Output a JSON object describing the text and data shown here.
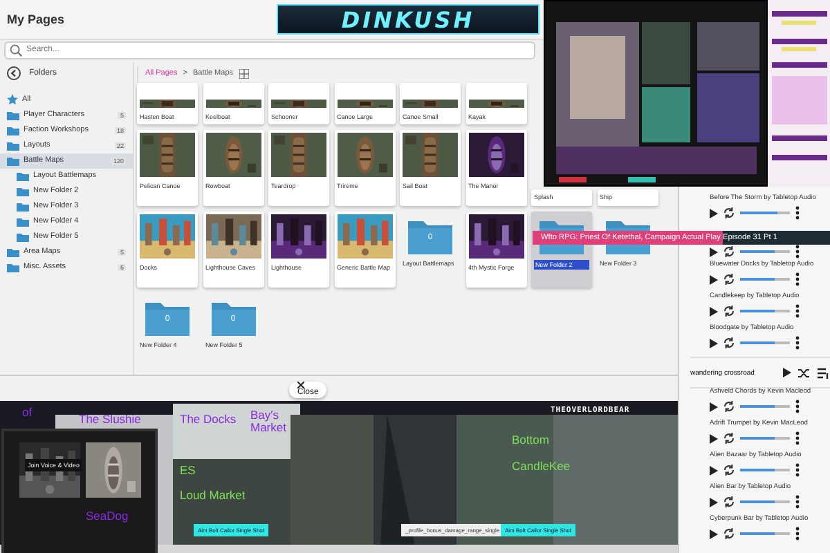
{
  "header": {
    "title": "My Pages",
    "logo": "DINKUSH"
  },
  "search": {
    "placeholder": "Search..."
  },
  "sidebar": {
    "title": "Folders",
    "items": [
      {
        "label": "All",
        "kind": "all",
        "selected": false
      },
      {
        "label": "Player Characters",
        "kind": "folder",
        "count": "5",
        "selected": false
      },
      {
        "label": "Faction Workshops",
        "kind": "folder",
        "count": "18",
        "selected": false
      },
      {
        "label": "Layouts",
        "kind": "folder",
        "count": "22",
        "selected": false
      },
      {
        "label": "Battle Maps",
        "kind": "folder",
        "count": "120",
        "selected": true,
        "children": [
          {
            "label": "Layout Battlemaps",
            "kind": "folder",
            "selected": false
          },
          {
            "label": "New Folder 2",
            "kind": "folder",
            "selected": false
          },
          {
            "label": "New Folder 3",
            "kind": "folder",
            "selected": false
          },
          {
            "label": "New Folder 4",
            "kind": "folder",
            "selected": false
          },
          {
            "label": "New Folder 5",
            "kind": "folder",
            "selected": false
          }
        ]
      },
      {
        "label": "Area Maps",
        "kind": "folder",
        "count": "5",
        "selected": false
      },
      {
        "label": "Misc. Assets",
        "kind": "folder",
        "count": "6",
        "selected": false
      }
    ]
  },
  "breadcrumb": {
    "root": "All Pages",
    "separator": ">",
    "current": "Battle Maps"
  },
  "grid": {
    "rows": [
      [
        {
          "name": "Hasten Boat",
          "kind": "picture",
          "selected": false
        },
        {
          "name": "Keelboat",
          "kind": "picture",
          "selected": false
        },
        {
          "name": "Schooner",
          "kind": "picture",
          "selected": false
        },
        {
          "name": "Canoe Large",
          "kind": "picture",
          "selected": false
        },
        {
          "name": "Canoe Small",
          "kind": "picture",
          "selected": false
        },
        {
          "name": "Kayak",
          "kind": "picture",
          "selected": false
        }
      ],
      [
        {
          "name": "Pelican Canoe",
          "kind": "picture",
          "selected": false
        },
        {
          "name": "Rowboat",
          "kind": "picture",
          "selected": false
        },
        {
          "name": "Teardrop",
          "kind": "picture",
          "selected": false
        },
        {
          "name": "Trireme",
          "kind": "picture",
          "selected": false
        },
        {
          "name": "Sail Boat",
          "kind": "picture",
          "selected": false
        },
        {
          "name": "The Manor",
          "kind": "picture",
          "selected": false
        },
        {
          "name": "Splash",
          "kind": "covered",
          "selected": false
        },
        {
          "name": "Ship",
          "kind": "covered",
          "selected": false
        }
      ],
      [
        {
          "name": "Docks",
          "kind": "picture",
          "selected": false
        },
        {
          "name": "Lighthouse Caves",
          "kind": "picture",
          "selected": false
        },
        {
          "name": "Lighthouse",
          "kind": "picture",
          "selected": false
        },
        {
          "name": "Generic Battle Map",
          "kind": "picture",
          "selected": false
        },
        {
          "name": "Layout Battlemaps",
          "kind": "folder",
          "count": "0",
          "selected": false
        },
        {
          "name": "4th Mystic Forge",
          "kind": "picture",
          "selected": false
        },
        {
          "name": "New Folder 2",
          "kind": "folder",
          "selected": true
        },
        {
          "name": "New Folder 3",
          "kind": "folder",
          "selected": false
        }
      ],
      [
        {
          "name": "New Folder 4",
          "kind": "folder",
          "count": "0",
          "selected": false
        },
        {
          "name": "New Folder 5",
          "kind": "folder",
          "count": "0",
          "selected": false
        }
      ]
    ]
  },
  "ticker": {
    "text": "Wfto RPG: Priest Of Ketethal, Campaign Actual Play Episode 31 Pt 1"
  },
  "audio": {
    "items": [
      {
        "kind": "track",
        "title": "Before The Storm by Tabletop Audio",
        "level": 0.75
      },
      {
        "kind": "track",
        "level": 0.7
      },
      {
        "kind": "track",
        "title": "Bluewater Docks by Tabletop Audio",
        "level": 0.7
      },
      {
        "kind": "track",
        "title": "Candlekeep by Tabletop Audio",
        "level": 0.7
      },
      {
        "kind": "track",
        "title": "Bloodgate by Tabletop Audio",
        "level": 0.7
      },
      {
        "kind": "playlist",
        "title": "wandering crossroad"
      },
      {
        "kind": "track",
        "title": "Ashveld Chords by Kevin Macleod",
        "level": 0.7
      },
      {
        "kind": "track",
        "title": "Adrift Trumpet by Kevin MacLeod",
        "level": 0.7
      },
      {
        "kind": "track",
        "title": "Alien Bazaar by Tabletop Audio",
        "level": 0.7
      },
      {
        "kind": "track",
        "title": "Alien Bar by Tabletop Audio",
        "level": 0.7
      },
      {
        "kind": "track",
        "title": "Cyberpunk Bar by Tabletop Audio",
        "level": 0.7
      }
    ]
  },
  "stage": {
    "close": "Close",
    "channel": "THEOVERLORDBEAR",
    "popup": "Join Voice & Video",
    "labels": [
      {
        "text": "of",
        "kind": "zone"
      },
      {
        "text": "The Slushie",
        "kind": "zone"
      },
      {
        "text": "The Docks",
        "kind": "zone"
      },
      {
        "text": "Bay's Market",
        "kind": "zone"
      },
      {
        "text": "ES",
        "kind": "sub"
      },
      {
        "text": "Loud Market",
        "kind": "sub"
      },
      {
        "text": "SeaDog",
        "kind": "zone"
      },
      {
        "text": "Bottom",
        "kind": "sub"
      },
      {
        "text": "CandleKee",
        "kind": "sub"
      }
    ],
    "tags": [
      {
        "text": "Aim Bolt Cailor Single Shot",
        "kind": "cyan"
      },
      {
        "text": "_profile_bonus_damage_range_single",
        "kind": "white"
      },
      {
        "text": "Aim Bolt Cailor Single Shot",
        "kind": "cyan"
      }
    ]
  }
}
